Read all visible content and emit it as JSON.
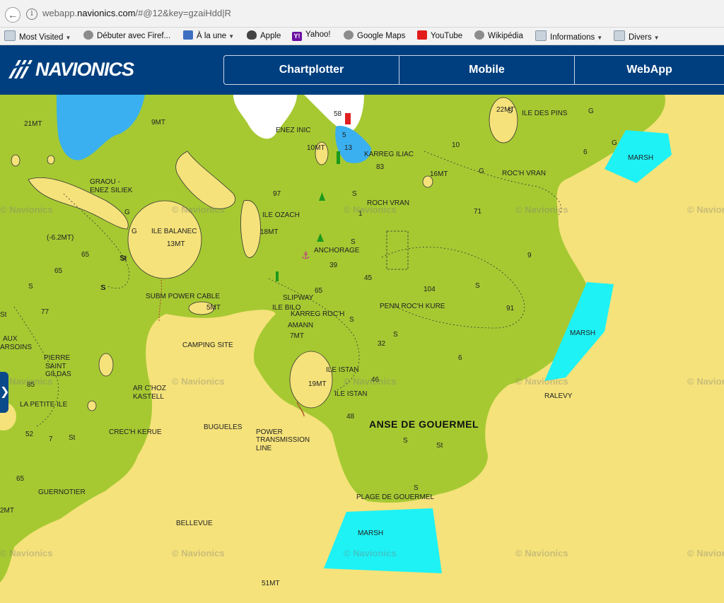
{
  "browser": {
    "url_prefix": "webapp.",
    "url_domain": "navionics.com",
    "url_rest": "/#@12&key=gzaiHdd|R",
    "bookmarks": [
      "Most Visited",
      "Débuter avec Firef...",
      "À la une",
      "Apple",
      "Yahoo!",
      "Google Maps",
      "YouTube",
      "Wikipédia",
      "Informations",
      "Divers"
    ],
    "yahoo_icon": "Y!"
  },
  "site": {
    "logo": "NAVIONICS",
    "nav": [
      "Chartplotter",
      "Mobile",
      "WebApp"
    ],
    "side_toggle": "❯"
  },
  "map": {
    "headline_label": "ANSE DE GOUERMEL",
    "labels": [
      "ILE DES PINS",
      "22MT",
      "KARREG ILIAC",
      "ROC'H VRAN",
      "ROCH VRAN",
      "MARSH",
      "ENEZ INIC",
      "10MT",
      "16MT",
      "GRAOU -",
      "ENEZ SILIEK",
      "9MT",
      "21MT",
      "ILE BALANEC",
      "13MT",
      "ILE OZACH",
      "18MT",
      "ANCHORAGE",
      "(-6.2MT)",
      "SUBM POWER CABLE",
      "5MT",
      "SLIPWAY",
      "ILE BILO",
      "KARREG ROC'H",
      "AMANN",
      "7MT",
      "PENN ROC'H KURE",
      "MARSH",
      "CAMPING SITE",
      "AUX",
      "ARSOINS",
      "PIERRE",
      "SAINT",
      "GILDAS",
      "ILE ISTAN",
      "19MT",
      "ILE ISTAN",
      "AR C'HOZ",
      "KASTELL",
      "LA PETITE ILE",
      "CREC'H KERUE",
      "BUGUELES",
      "POWER",
      "TRANSMISSION",
      "LINE",
      "RALEVY",
      "GUERNOTIER",
      "PLAGE DE GOUERMEL",
      "MARSH",
      "BELLEVUE",
      "51MT",
      "2MT"
    ],
    "soundings": [
      "58",
      "5",
      "13",
      "83",
      "10",
      "6",
      "G",
      "97",
      "S",
      "1",
      "71",
      "G",
      "S",
      "G",
      "G",
      "S",
      "St",
      "65",
      "65",
      "S",
      "39",
      "45",
      "S",
      "S",
      "104",
      "91",
      "S",
      "65",
      "St",
      "77",
      "St",
      "S",
      "32",
      "6",
      "46",
      "85",
      "48",
      "7",
      "St",
      "52",
      "S",
      "St",
      "65",
      "S",
      "S",
      "G",
      "9"
    ],
    "watermark": "© Navionics"
  }
}
